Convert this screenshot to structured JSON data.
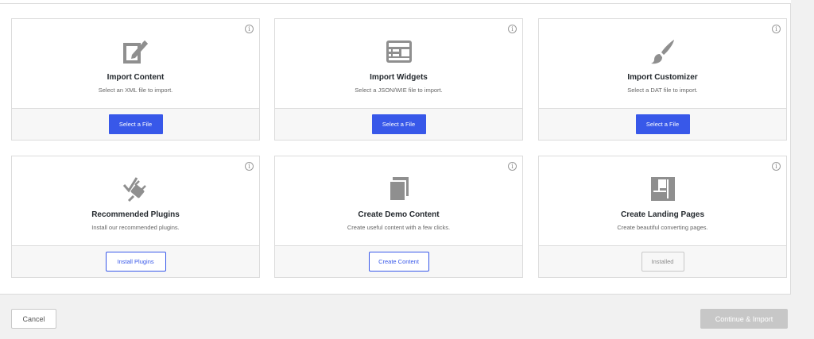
{
  "cards": [
    {
      "title": "Import Content",
      "desc": "Select an XML file to import.",
      "button": "Select a File",
      "icon": "import-content-icon"
    },
    {
      "title": "Import Widgets",
      "desc": "Select a JSON/WIE file to import.",
      "button": "Select a File",
      "icon": "widgets-icon"
    },
    {
      "title": "Import Customizer",
      "desc": "Select a DAT file to import.",
      "button": "Select a File",
      "icon": "paintbrush-icon"
    },
    {
      "title": "Recommended Plugins",
      "desc": "Install our recommended plugins.",
      "button": "Install Plugins",
      "icon": "plugin-icon"
    },
    {
      "title": "Create Demo Content",
      "desc": "Create useful content with a few clicks.",
      "button": "Create Content",
      "icon": "copy-pages-icon"
    },
    {
      "title": "Create Landing Pages",
      "desc": "Create beautiful converting pages.",
      "button": "Installed",
      "icon": "layout-icon"
    }
  ],
  "footer": {
    "cancel": "Cancel",
    "continue": "Continue & Import"
  },
  "info_glyph": "i",
  "colors": {
    "accent": "#3858e9",
    "icon": "#8f8f8f",
    "disabled": "#c7c7c7"
  }
}
